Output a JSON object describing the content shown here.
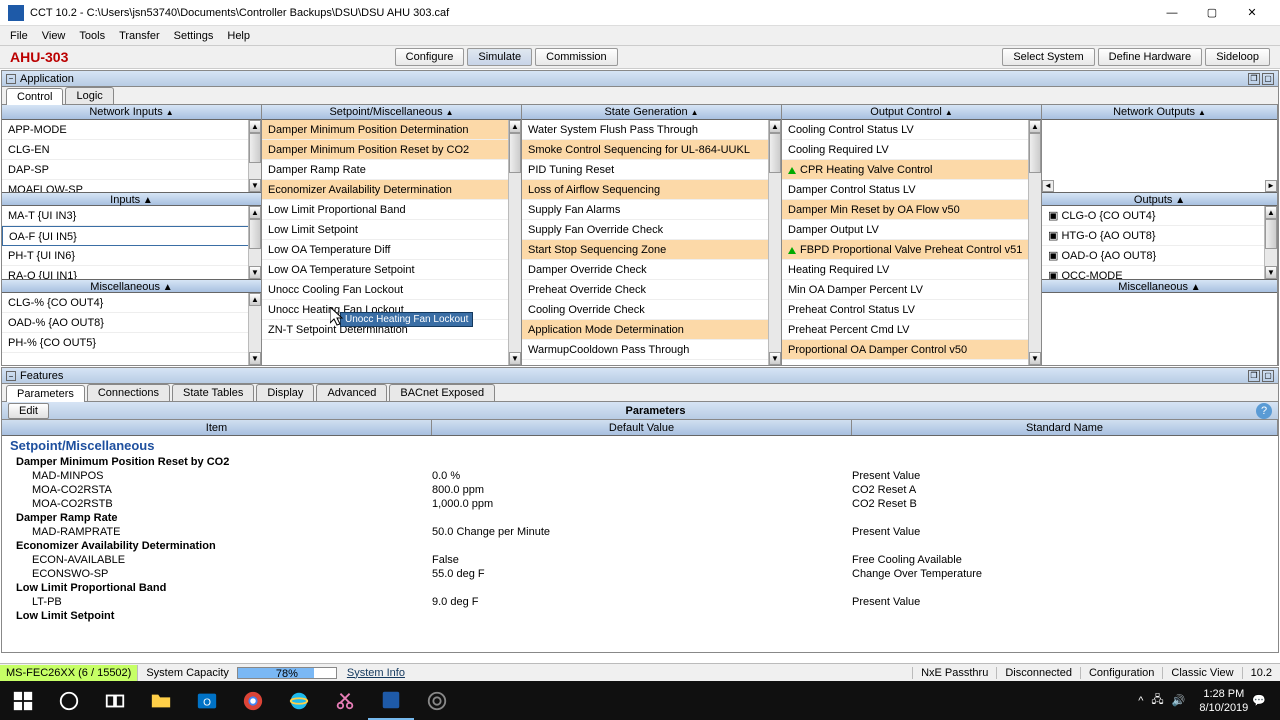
{
  "window": {
    "title": "CCT 10.2 - C:\\Users\\jsn53740\\Documents\\Controller Backups\\DSU\\DSU AHU 303.caf",
    "minimize": "—",
    "maximize": "▢",
    "close": "✕"
  },
  "menu": [
    "File",
    "View",
    "Tools",
    "Transfer",
    "Settings",
    "Help"
  ],
  "device_title": "AHU-303",
  "header_buttons": {
    "left": [
      "Configure",
      "Simulate",
      "Commission"
    ],
    "right": [
      "Select System",
      "Define Hardware",
      "Sideloop"
    ]
  },
  "app_panel": {
    "title": "Application",
    "tabs": [
      "Control",
      "Logic"
    ]
  },
  "columns": {
    "network_inputs": {
      "title": "Network Inputs",
      "items": [
        "APP-MODE",
        "CLG-EN",
        "DAP-SP",
        "MOAFLOW-SP"
      ]
    },
    "inputs": {
      "title": "Inputs",
      "items": [
        "MA-T {UI IN3}",
        "OA-F {UI IN5}",
        "PH-T {UI IN6}",
        "RA-O {UI IN1}"
      ],
      "selected": 1
    },
    "misc_left": {
      "title": "Miscellaneous",
      "items": [
        "CLG-% {CO OUT4}",
        "OAD-% {AO OUT8}",
        "PH-% {CO OUT5}"
      ]
    },
    "setpoint": {
      "title": "Setpoint/Miscellaneous",
      "items": [
        {
          "t": "Damper Minimum Position Determination",
          "hl": true
        },
        {
          "t": "Damper Minimum Position Reset by CO2",
          "hl": true
        },
        {
          "t": "Damper Ramp Rate",
          "hl": false
        },
        {
          "t": "Economizer Availability Determination",
          "hl": true
        },
        {
          "t": "Low Limit Proportional Band",
          "hl": false
        },
        {
          "t": "Low Limit Setpoint",
          "hl": false
        },
        {
          "t": "Low OA Temperature Diff",
          "hl": false
        },
        {
          "t": "Low OA Temperature Setpoint",
          "hl": false
        },
        {
          "t": "Unocc Cooling Fan Lockout",
          "hl": false
        },
        {
          "t": "Unocc Heating Fan Lockout",
          "hl": false
        },
        {
          "t": "ZN-T Setpoint Determination",
          "hl": false
        }
      ],
      "tooltip": "Unocc Heating Fan Lockout"
    },
    "state_gen": {
      "title": "State Generation",
      "items": [
        {
          "t": "Water System Flush Pass Through",
          "hl": false
        },
        {
          "t": "Smoke Control Sequencing for UL-864-UUKL",
          "hl": true
        },
        {
          "t": "PID Tuning Reset",
          "hl": false
        },
        {
          "t": "Loss of Airflow Sequencing",
          "hl": true
        },
        {
          "t": "Supply Fan Alarms",
          "hl": false
        },
        {
          "t": "Supply Fan Override Check",
          "hl": false
        },
        {
          "t": "Start Stop Sequencing Zone",
          "hl": true
        },
        {
          "t": "Damper Override Check",
          "hl": false
        },
        {
          "t": "Preheat Override Check",
          "hl": false
        },
        {
          "t": "Cooling Override Check",
          "hl": false
        },
        {
          "t": "Application Mode Determination",
          "hl": true
        },
        {
          "t": "WarmupCooldown Pass Through",
          "hl": false
        }
      ]
    },
    "output_ctrl": {
      "title": "Output Control",
      "items": [
        {
          "t": "Cooling Control Status LV",
          "hl": false,
          "m": ""
        },
        {
          "t": "Cooling Required LV",
          "hl": false,
          "m": ""
        },
        {
          "t": "CPR Heating Valve Control",
          "hl": true,
          "m": "g"
        },
        {
          "t": "Damper Control Status LV",
          "hl": false,
          "m": ""
        },
        {
          "t": "Damper Min Reset by OA Flow v50",
          "hl": true,
          "m": ""
        },
        {
          "t": "Damper Output LV",
          "hl": false,
          "m": ""
        },
        {
          "t": "FBPD Proportional Valve Preheat Control v51",
          "hl": true,
          "m": "g"
        },
        {
          "t": "Heating Required LV",
          "hl": false,
          "m": ""
        },
        {
          "t": "Min OA Damper Percent LV",
          "hl": false,
          "m": ""
        },
        {
          "t": "Preheat Control Status LV",
          "hl": false,
          "m": ""
        },
        {
          "t": "Preheat Percent Cmd LV",
          "hl": false,
          "m": ""
        },
        {
          "t": "Proportional OA Damper Control v50",
          "hl": true,
          "m": ""
        }
      ]
    },
    "network_outputs": {
      "title": "Network Outputs"
    },
    "outputs": {
      "title": "Outputs",
      "items": [
        "CLG-O {CO OUT4}",
        "HTG-O {AO OUT8}",
        "OAD-O {AO OUT8}",
        "OCC-MODE"
      ]
    },
    "misc_right": {
      "title": "Miscellaneous"
    }
  },
  "features": {
    "title": "Features",
    "tabs": [
      "Parameters",
      "Connections",
      "State Tables",
      "Display",
      "Advanced",
      "BACnet Exposed"
    ],
    "edit": "Edit",
    "panel_title": "Parameters",
    "headers": [
      "Item",
      "Default Value",
      "Standard Name"
    ],
    "group": "Setpoint/Miscellaneous",
    "sections": [
      {
        "name": "Damper Minimum Position Reset by CO2",
        "rows": [
          {
            "i": "MAD-MINPOS",
            "v": "0.0 %",
            "s": "Present Value"
          },
          {
            "i": "MOA-CO2RSTA",
            "v": "800.0 ppm",
            "s": "CO2 Reset A"
          },
          {
            "i": "MOA-CO2RSTB",
            "v": "1,000.0 ppm",
            "s": "CO2 Reset B"
          }
        ]
      },
      {
        "name": "Damper Ramp Rate",
        "rows": [
          {
            "i": "MAD-RAMPRATE",
            "v": "50.0 Change per Minute",
            "s": "Present Value"
          }
        ]
      },
      {
        "name": "Economizer Availability Determination",
        "rows": [
          {
            "i": "ECON-AVAILABLE",
            "v": "False",
            "s": "Free Cooling Available"
          },
          {
            "i": "ECONSWO-SP",
            "v": "55.0 deg F",
            "s": "Change Over Temperature"
          }
        ]
      },
      {
        "name": "Low Limit Proportional Band",
        "rows": [
          {
            "i": "LT-PB",
            "v": "9.0 deg F",
            "s": "Present Value"
          }
        ]
      },
      {
        "name": "Low Limit Setpoint",
        "rows": []
      }
    ]
  },
  "status": {
    "device": "MS-FEC26XX (6 / 15502)",
    "capacity_label": "System Capacity",
    "capacity_pct": "78%",
    "info": "System Info",
    "right": [
      "NxE Passthru",
      "Disconnected",
      "Configuration",
      "Classic View",
      "10.2"
    ]
  },
  "taskbar": {
    "time": "1:28 PM",
    "date": "8/10/2019",
    "tray_up": "^"
  }
}
